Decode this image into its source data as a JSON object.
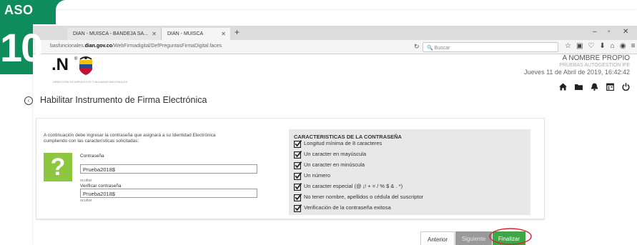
{
  "step": {
    "label": "ASO",
    "number": "10"
  },
  "browser": {
    "tabs": [
      {
        "label": "DIAN - MUISCA - BANDEJA SA...",
        "active": false
      },
      {
        "label": "DIAN - MUISCA",
        "active": true
      }
    ],
    "url_prefix": "basfuncionales.",
    "url_domain": "dian.gov.co",
    "url_path": "/WebFirmadigital/DefPreguntasFirmaDigital.faces",
    "search_placeholder": "Buscar"
  },
  "header": {
    "logo_text": ".N",
    "logo_subtext": "DIRECCIÓN DE IMPUESTOS Y ADUANAS NACIONALES",
    "user_name": "A NOMBRE PROPIO",
    "user_profile": "PRUEBAS AUTOGESTION IFE",
    "datetime": "Jueves 11 de Abril de 2019, 16:42:42"
  },
  "page": {
    "title": "Habilitar Instrumento de Firma Electrónica"
  },
  "form": {
    "intro": "A continuación debe ingresar la contraseña que asignará a su Identidad Electrónica cumpliendo con las características solicitadas:",
    "question_mark": "?",
    "password_label": "Contraseña",
    "password_value": "Prueba2018$",
    "password_toggle": "ocultar",
    "verify_label": "Verificar contraseña",
    "verify_value": "Prueba2018$",
    "verify_toggle": "ocultar"
  },
  "rules": {
    "title": "CARACTERISTICAS DE LA CONTRASEÑA",
    "items": [
      "Longitud mínima de 8 caracteres",
      "Un caracter en mayúscula",
      "Un caracter en minúscula",
      "Un número",
      "Un caracter especial (@ ¡! + = / % $ & . *)",
      "No tener nombre, apellidos o cédula del suscriptor",
      "Verificación de la contraseña exitosa"
    ]
  },
  "buttons": {
    "previous": "Anterior",
    "next": "Siguiente",
    "finish": "Finalizar"
  },
  "colors": {
    "brand_green": "#0f8c5b",
    "finish_green": "#3fa648",
    "question_green": "#8dc63f",
    "highlight_red": "#d9232d"
  }
}
